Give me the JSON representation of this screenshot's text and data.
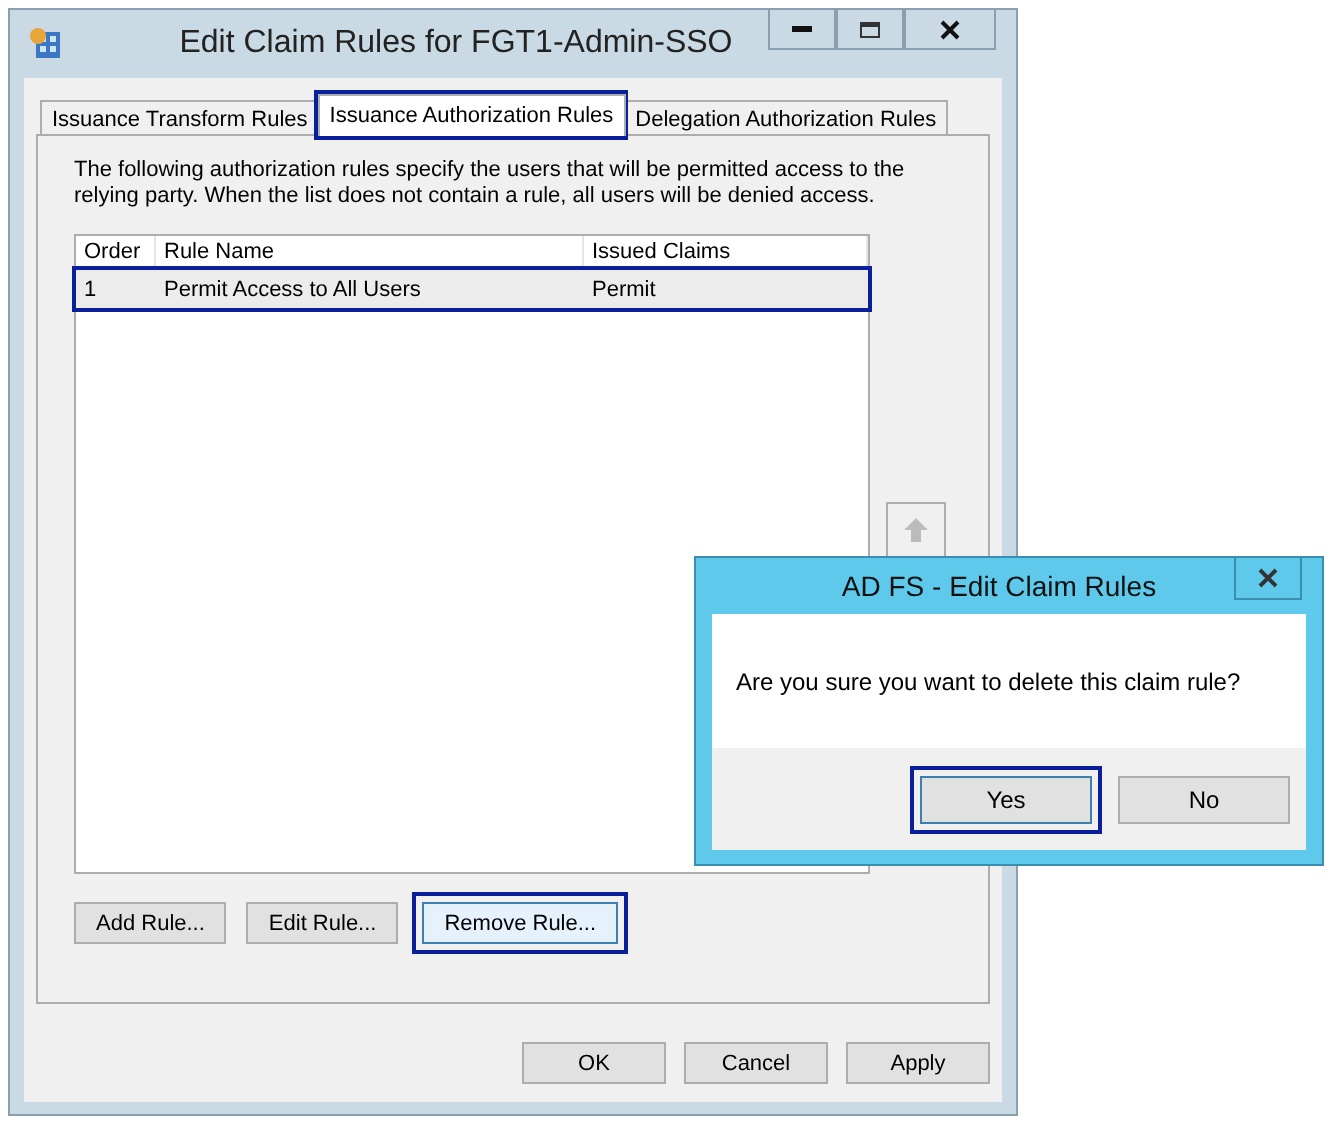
{
  "window": {
    "title": "Edit Claim Rules for FGT1-Admin-SSO"
  },
  "tabs": [
    {
      "label": "Issuance Transform Rules",
      "selected": false,
      "highlighted": false
    },
    {
      "label": "Issuance Authorization Rules",
      "selected": true,
      "highlighted": true
    },
    {
      "label": "Delegation Authorization Rules",
      "selected": false,
      "highlighted": false
    }
  ],
  "description": "The following authorization rules specify the users that will be permitted access to the relying party. When the list does not contain a rule, all users will be denied access.",
  "rules_list": {
    "columns": [
      "Order",
      "Rule Name",
      "Issued Claims"
    ],
    "rows": [
      {
        "cells": [
          "1",
          "Permit Access to All Users",
          "Permit"
        ],
        "selected": true,
        "highlighted": true
      }
    ]
  },
  "rule_buttons": [
    {
      "label": "Add Rule...",
      "highlighted": false
    },
    {
      "label": "Edit Rule...",
      "highlighted": false
    },
    {
      "label": "Remove Rule...",
      "highlighted": true
    }
  ],
  "footer_buttons": [
    "OK",
    "Cancel",
    "Apply"
  ],
  "dialog": {
    "title": "AD FS - Edit Claim Rules",
    "message": "Are you sure you want to delete this claim rule?",
    "buttons": [
      {
        "label": "Yes",
        "highlighted": true
      },
      {
        "label": "No",
        "highlighted": false
      }
    ]
  }
}
